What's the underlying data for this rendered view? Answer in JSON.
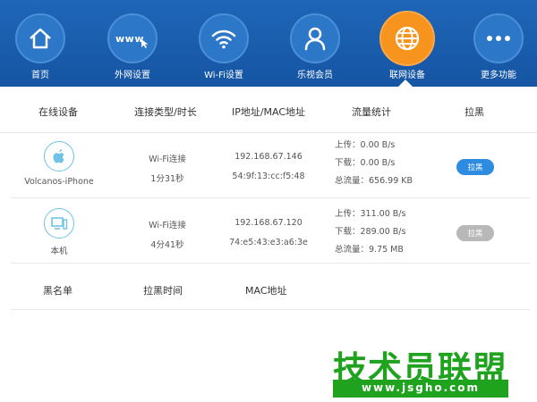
{
  "nav": {
    "items": [
      {
        "label": "首页",
        "icon": "home-icon"
      },
      {
        "label": "外网设置",
        "icon": "www-cursor-icon",
        "icon_text": "www"
      },
      {
        "label": "Wi-Fi设置",
        "icon": "wifi-icon"
      },
      {
        "label": "乐视会员",
        "icon": "user-icon"
      },
      {
        "label": "联网设备",
        "icon": "globe-icon",
        "active": true
      },
      {
        "label": "更多功能",
        "icon": "more-dots-icon"
      }
    ],
    "colors": {
      "bar": "#1555a3",
      "active": "#f7941d",
      "circle": "#2d77c8"
    }
  },
  "devices_table": {
    "headers": [
      "在线设备",
      "连接类型/时长",
      "IP地址/MAC地址",
      "流量统计",
      "拉黑"
    ],
    "rows": [
      {
        "name": "Volcanos-iPhone",
        "icon": "apple-icon",
        "conn_type": "Wi-Fi连接",
        "duration": "1分31秒",
        "ip": "192.168.67.146",
        "mac": "54:9f:13:cc:f5:48",
        "upload": "上传：0.00 B/s",
        "download": "下载：0.00 B/s",
        "total": "总流量：656.99 KB",
        "block_label": "拉黑",
        "block_enabled": true
      },
      {
        "name": "本机",
        "icon": "computer-icon",
        "conn_type": "Wi-Fi连接",
        "duration": "4分41秒",
        "ip": "192.168.67.120",
        "mac": "74:e5:43:e3:a6:3e",
        "upload": "上传：311.00 B/s",
        "download": "下载：289.00 B/s",
        "total": "总流量：9.75 MB",
        "block_label": "拉黑",
        "block_enabled": false
      }
    ]
  },
  "blacklist": {
    "headers": [
      "黑名单",
      "拉黑时间",
      "MAC地址"
    ]
  },
  "watermark": {
    "title": "技术员联盟",
    "url": "www.jsgho.com",
    "color": "#1fa31f"
  }
}
